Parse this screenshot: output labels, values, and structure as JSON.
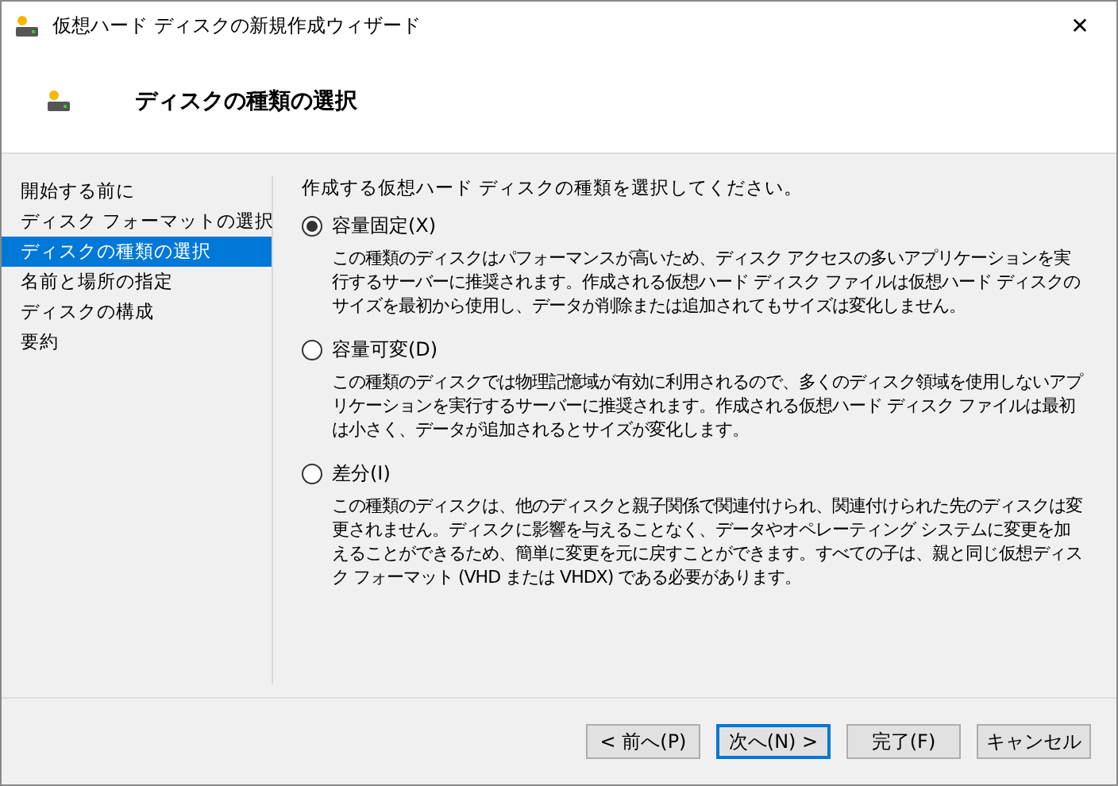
{
  "window": {
    "title": "仮想ハード ディスクの新規作成ウィザード",
    "close": "✕"
  },
  "header": {
    "title": "ディスクの種類の選択"
  },
  "sidebar": {
    "items": [
      {
        "label": "開始する前に",
        "selected": false
      },
      {
        "label": "ディスク フォーマットの選択",
        "selected": false
      },
      {
        "label": "ディスクの種類の選択",
        "selected": true
      },
      {
        "label": "名前と場所の指定",
        "selected": false
      },
      {
        "label": "ディスクの構成",
        "selected": false
      },
      {
        "label": "要約",
        "selected": false
      }
    ]
  },
  "content": {
    "instruction": "作成する仮想ハード ディスクの種類を選択してください。",
    "options": [
      {
        "label": "容量固定(X)",
        "selected": true,
        "description": "この種類のディスクはパフォーマンスが高いため、ディスク アクセスの多いアプリケーションを実行するサーバーに推奨されます。作成される仮想ハード ディスク ファイルは仮想ハード ディスクのサイズを最初から使用し、データが削除または追加されてもサイズは変化しません。"
      },
      {
        "label": "容量可変(D)",
        "selected": false,
        "description": "この種類のディスクでは物理記憶域が有効に利用されるので、多くのディスク領域を使用しないアプリケーションを実行するサーバーに推奨されます。作成される仮想ハード ディスク ファイルは最初は小さく、データが追加されるとサイズが変化します。"
      },
      {
        "label": "差分(I)",
        "selected": false,
        "description": "この種類のディスクは、他のディスクと親子関係で関連付けられ、関連付けられた先のディスクは変更されません。ディスクに影響を与えることなく、データやオペレーティング システムに変更を加えることができるため、簡単に変更を元に戻すことができます。すべての子は、親と同じ仮想ディスク フォーマット (VHD または VHDX) である必要があります。"
      }
    ]
  },
  "buttons": [
    {
      "label": "< 前へ(P)",
      "focused": false
    },
    {
      "label": "次へ(N) >",
      "focused": true
    },
    {
      "label": "完了(F)",
      "focused": false
    },
    {
      "label": "キャンセル",
      "focused": false
    }
  ]
}
